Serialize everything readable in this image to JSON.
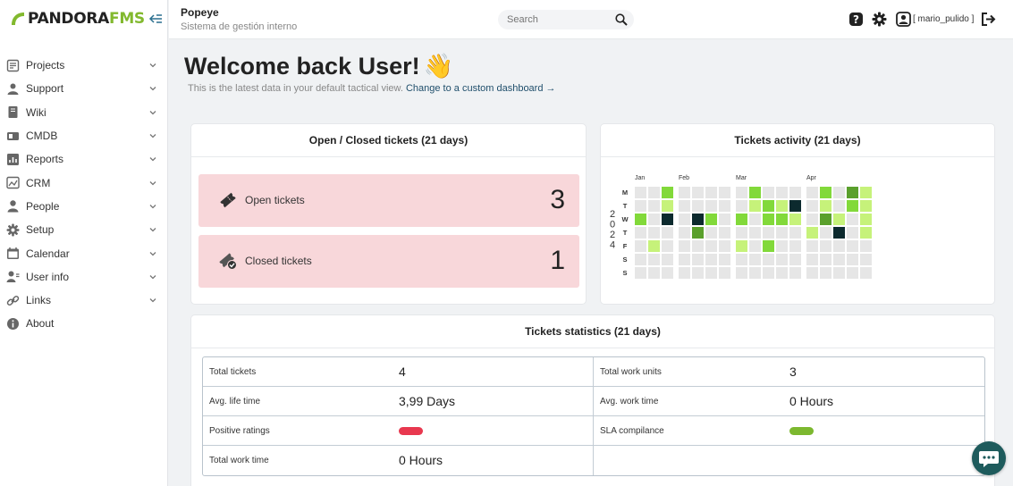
{
  "app": {
    "logo_prefix": "PANDORA",
    "logo_suffix": "FMS",
    "brand_color": "#82b92e"
  },
  "sidebar": {
    "items": [
      {
        "label": "Projects",
        "icon": "projects-icon",
        "expandable": true
      },
      {
        "label": "Support",
        "icon": "support-icon",
        "expandable": true
      },
      {
        "label": "Wiki",
        "icon": "wiki-icon",
        "expandable": true
      },
      {
        "label": "CMDB",
        "icon": "cmdb-icon",
        "expandable": true
      },
      {
        "label": "Reports",
        "icon": "reports-icon",
        "expandable": true
      },
      {
        "label": "CRM",
        "icon": "crm-icon",
        "expandable": true
      },
      {
        "label": "People",
        "icon": "people-icon",
        "expandable": true
      },
      {
        "label": "Setup",
        "icon": "gear-icon",
        "expandable": true
      },
      {
        "label": "Calendar",
        "icon": "calendar-icon",
        "expandable": true
      },
      {
        "label": "User info",
        "icon": "user-info-icon",
        "expandable": true
      },
      {
        "label": "Links",
        "icon": "link-icon",
        "expandable": true
      },
      {
        "label": "About",
        "icon": "info-icon",
        "expandable": false
      }
    ]
  },
  "header": {
    "title": "Popeye",
    "subtitle": "Sistema de gestión interno",
    "search_placeholder": "Search",
    "user": "[ mario_pulido ]"
  },
  "welcome": {
    "title": "Welcome back User!",
    "emoji": "👋",
    "subtitle": "This is the latest data in your default tactical view.",
    "link": "Change to a custom dashboard →"
  },
  "open_closed": {
    "title": "Open / Closed tickets (21 days)",
    "open_label": "Open tickets",
    "open_count": "3",
    "closed_label": "Closed tickets",
    "closed_count": "1",
    "box_color": "#f8d7da"
  },
  "activity": {
    "title": "Tickets activity (21 days)",
    "year": "2024",
    "months": [
      "Jan",
      "Feb",
      "Mar",
      "Apr"
    ],
    "days": [
      "M",
      "T",
      "W",
      "T",
      "F",
      "S",
      "S"
    ],
    "levels": {
      "0": "#e6e6e6",
      "1": "#c6f27a",
      "2": "#82d93a",
      "3": "#5aa02c",
      "4": "#0c2a2e"
    },
    "weeks": [
      [
        0,
        0,
        2,
        0,
        0,
        0,
        0
      ],
      [
        0,
        0,
        0,
        0,
        1,
        0,
        0
      ],
      [
        2,
        1,
        4,
        0,
        0,
        0,
        0
      ],
      [
        0,
        0,
        0,
        0,
        0,
        0,
        0
      ],
      [
        0,
        0,
        4,
        3,
        0,
        0,
        0
      ],
      [
        0,
        0,
        2,
        0,
        0,
        0,
        0
      ],
      [
        0,
        0,
        0,
        0,
        0,
        0,
        0
      ],
      [
        0,
        0,
        2,
        0,
        1,
        0,
        0
      ],
      [
        2,
        1,
        0,
        0,
        0,
        0,
        0
      ],
      [
        0,
        2,
        2,
        0,
        2,
        0,
        0
      ],
      [
        0,
        1,
        2,
        0,
        0,
        0,
        0
      ],
      [
        0,
        4,
        1,
        0,
        0,
        0,
        0
      ],
      [
        0,
        0,
        0,
        1,
        0,
        0,
        0
      ],
      [
        2,
        1,
        3,
        0,
        0,
        0,
        0
      ],
      [
        0,
        0,
        1,
        4,
        0,
        0,
        0
      ],
      [
        3,
        2,
        0,
        0,
        0,
        0,
        0
      ],
      [
        1,
        1,
        1,
        1,
        0,
        0,
        0
      ]
    ]
  },
  "stats": {
    "title": "Tickets statistics (21 days)",
    "rows": [
      {
        "l_label": "Total tickets",
        "l_value": "4",
        "r_label": "Total work units",
        "r_value": "3"
      },
      {
        "l_label": "Avg. life time",
        "l_value": "3,99 Days",
        "r_label": "Avg. work time",
        "r_value": "0 Hours"
      },
      {
        "l_label": "Positive ratings",
        "l_bar": "#e8384f",
        "r_label": "SLA compilance",
        "r_bar": "#7cb82f"
      },
      {
        "l_label": "Total work time",
        "l_value": "0 Hours",
        "r_label": "",
        "r_value": ""
      }
    ]
  },
  "chat": {
    "icon": "chat-icon"
  }
}
